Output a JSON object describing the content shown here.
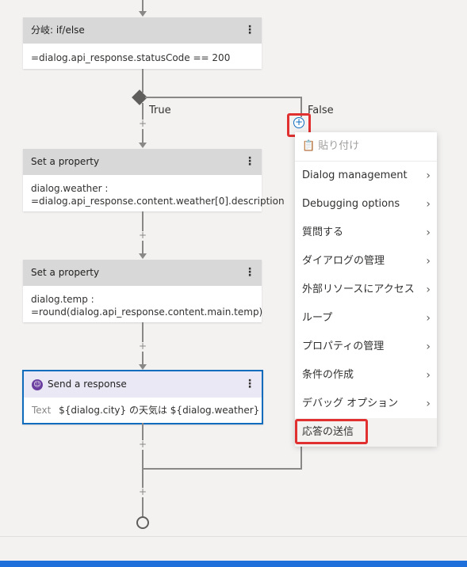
{
  "cards": {
    "ifelse": {
      "title": "分岐: if/else",
      "body": "=dialog.api_response.statusCode == 200"
    },
    "set1": {
      "title": "Set a property",
      "line1": "dialog.weather :",
      "line2": "=dialog.api_response.content.weather[0].description"
    },
    "set2": {
      "title": "Set a property",
      "line1": "dialog.temp :",
      "line2": "=round(dialog.api_response.content.main.temp)"
    },
    "response": {
      "title": "Send a response",
      "label": "Text",
      "text": "${dialog.city} の天気は ${dialog.weather} で、温..."
    }
  },
  "branches": {
    "true_label": "True",
    "false_label": "False"
  },
  "menu": {
    "paste": "貼り付け",
    "items": [
      {
        "label": "Dialog management"
      },
      {
        "label": "Debugging options"
      },
      {
        "label": "質問する"
      },
      {
        "label": "ダイアログの管理"
      },
      {
        "label": "外部リソースにアクセス"
      },
      {
        "label": "ループ"
      },
      {
        "label": "プロパティの管理"
      },
      {
        "label": "条件の作成"
      },
      {
        "label": "デバッグ オプション"
      }
    ],
    "send_response": "応答の送信"
  },
  "colors": {
    "accent": "#0f6cbd",
    "highlight": "#e03030",
    "taskbar": "#1e6fd9"
  },
  "icons": {
    "menu": "more-vertical-icon",
    "chevron": "chevron-right-icon",
    "add": "plus-icon",
    "bot": "bot-icon",
    "paste": "clipboard-icon"
  }
}
